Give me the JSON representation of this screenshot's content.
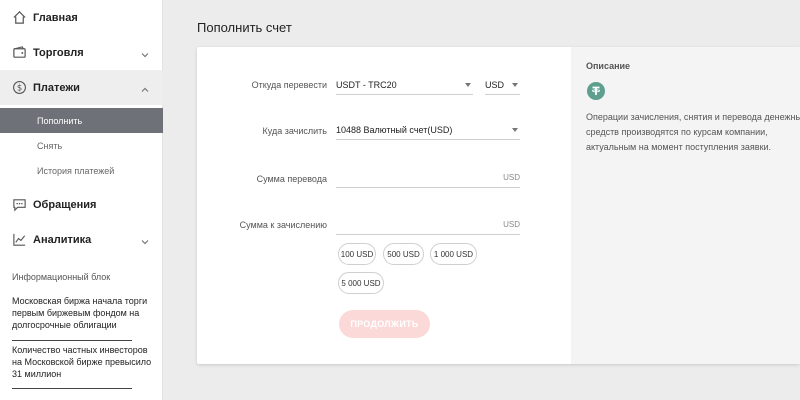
{
  "sidebar": {
    "items": [
      {
        "label": "Главная",
        "icon": "home-icon"
      },
      {
        "label": "Торговля",
        "icon": "wallet-icon"
      },
      {
        "label": "Платежи",
        "icon": "dollar-icon"
      },
      {
        "label": "Обращения",
        "icon": "chat-icon"
      },
      {
        "label": "Аналитика",
        "icon": "chart-icon"
      }
    ],
    "sub_items": [
      {
        "label": "Пополнить",
        "active": true
      },
      {
        "label": "Снять",
        "active": false
      },
      {
        "label": "История платежей",
        "active": false
      }
    ],
    "info_block": {
      "title": "Информационный блок",
      "news": [
        "Московская биржа начала торги первым биржевым фондом на долгосрочные облигации",
        "Количество частных инвесторов на Московской бирже превысило 31 миллион"
      ]
    }
  },
  "page": {
    "title": "Пополнить счет"
  },
  "form": {
    "from_label": "Откуда перевести",
    "from_value": "USDT - TRC20",
    "currency_value": "USD",
    "to_label": "Куда зачислить",
    "to_value": "10488 Валютный счет(USD)",
    "amount_label": "Сумма перевода",
    "amount_unit": "USD",
    "credit_label": "Сумма к зачислению",
    "credit_unit": "USD",
    "presets": [
      "100 USD",
      "500 USD",
      "1 000 USD",
      "5 000 USD"
    ],
    "submit_label": "ПРОДОЛЖИТЬ"
  },
  "description": {
    "title": "Описание",
    "text_lines": [
      "Операции зачисления, снятия и перевода денежных",
      "средств производятся по курсам компании,",
      "актуальным на момент поступления заявки."
    ]
  },
  "colors": {
    "active_sub": "#6e7178",
    "tether": "#5ea08d",
    "submit_disabled": "#fbd9d9"
  }
}
